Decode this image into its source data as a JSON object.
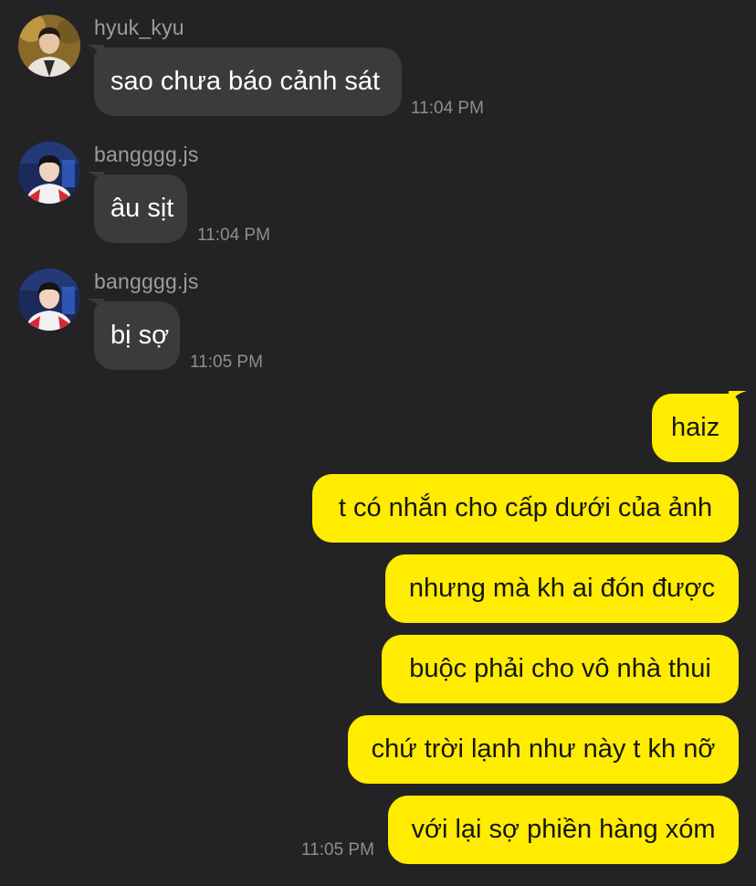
{
  "colors": {
    "background": "#232325",
    "incoming_bubble": "#3b3b3d",
    "outgoing_bubble": "#ffec00",
    "name_text": "#9c9ca0",
    "timestamp_text": "#8e8e92"
  },
  "messages": [
    {
      "sender": "hyuk_kyu",
      "avatar_icon": "user-avatar-hyuk-kyu",
      "text": "sao chưa báo cảnh sát",
      "time": "11:04 PM"
    },
    {
      "sender": "bangggg.js",
      "avatar_icon": "user-avatar-bangggg-js",
      "text": "âu sịt",
      "time": "11:04 PM"
    },
    {
      "sender": "bangggg.js",
      "avatar_icon": "user-avatar-bangggg-js",
      "text": "bị sợ",
      "time": "11:05 PM"
    }
  ],
  "outgoing": {
    "messages": [
      "haiz",
      "t có nhắn cho cấp dưới của ảnh",
      "nhưng mà kh ai đón được",
      "buộc phải cho vô nhà thui",
      "chứ trời lạnh như này t kh nỡ",
      "với lại sợ phiền hàng xóm"
    ],
    "time": "11:05 PM"
  }
}
